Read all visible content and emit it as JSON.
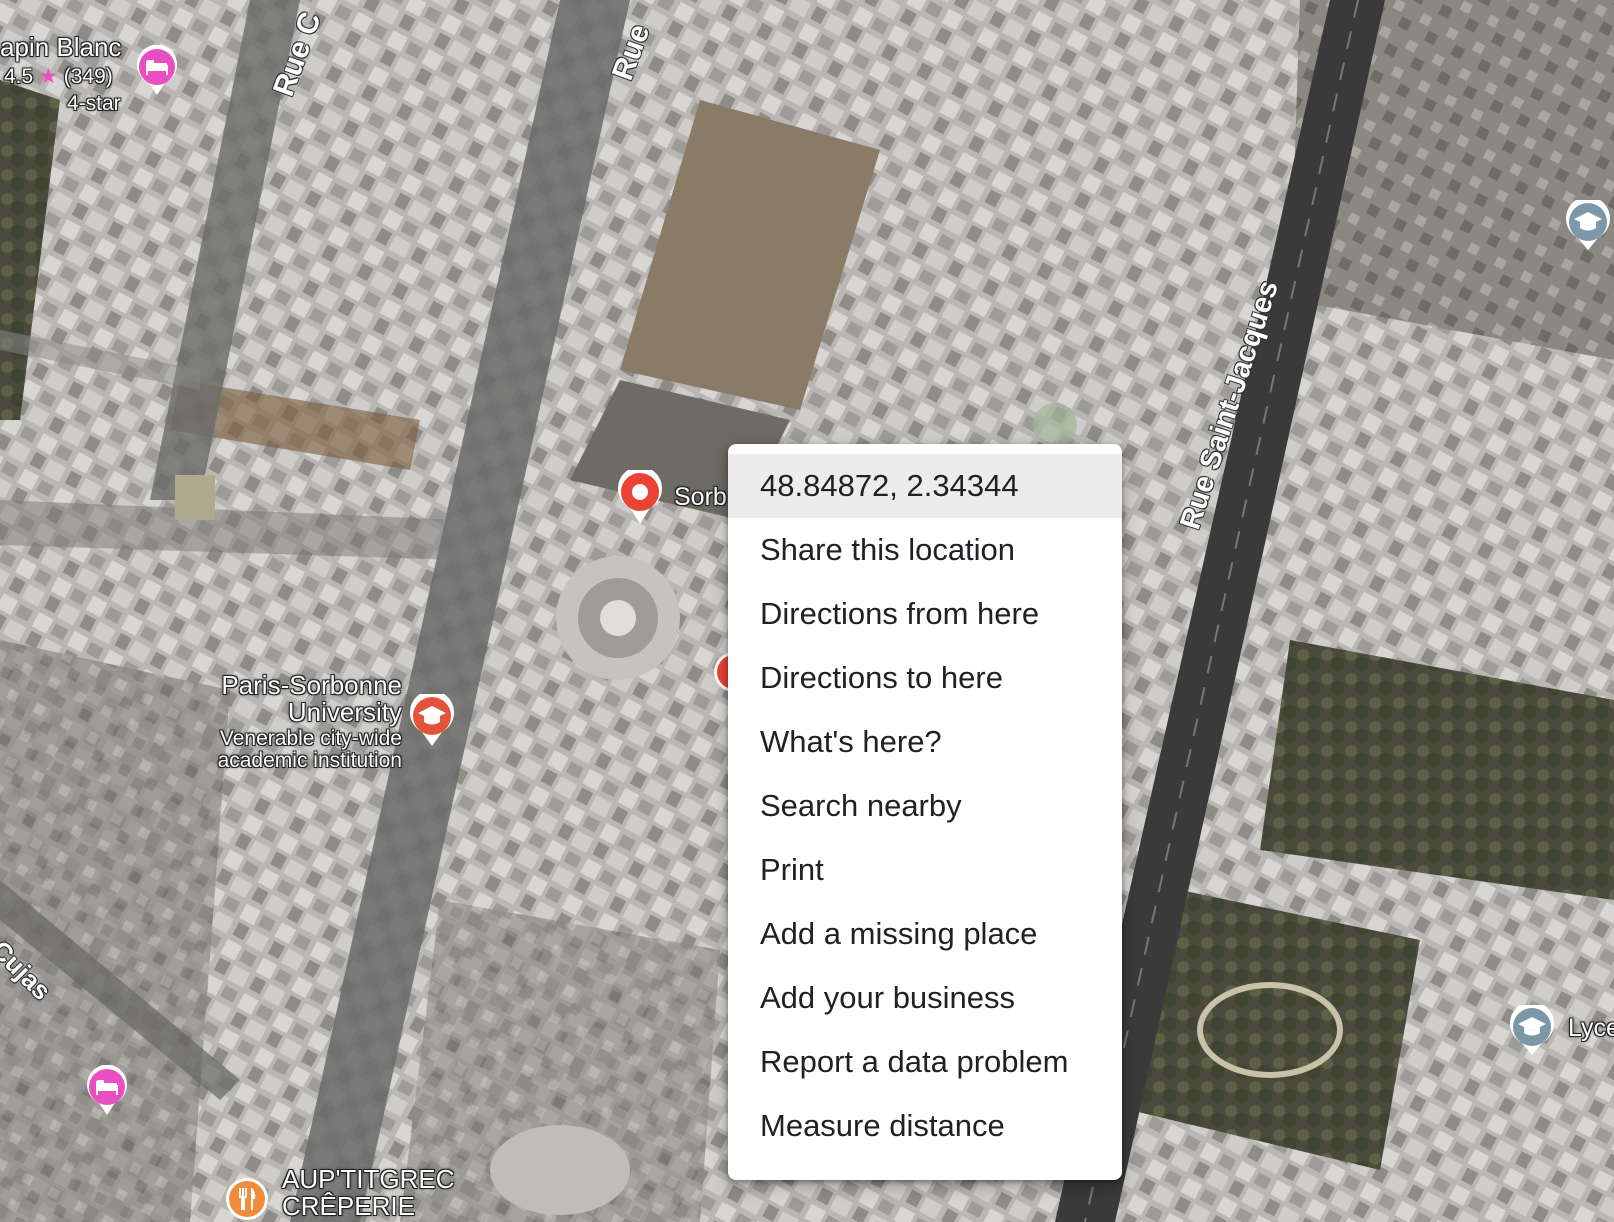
{
  "context_menu": {
    "coordinates": "48.84872, 2.34344",
    "items": [
      "Share this location",
      "Directions from here",
      "Directions to here",
      "What's here?",
      "Search nearby",
      "Print",
      "Add a missing place",
      "Add your business",
      "Report a data problem",
      "Measure distance"
    ]
  },
  "places": {
    "hotel_top": {
      "name": "apin Blanc",
      "rating": "4.5",
      "star": "★",
      "reviews": "(349)",
      "category": "4-star"
    },
    "university": {
      "name_line1": "Paris-Sorbonne",
      "name_line2": "University",
      "desc_line1": "Venerable city-wide",
      "desc_line2": "academic institution"
    },
    "sorbonne_pin_label": "Sorb",
    "lycee_label": "Lyce",
    "creperie_line1": "AUP'TITGREC",
    "creperie_line2": "CRÊPERIE"
  },
  "streets": {
    "rue_c": "Rue C",
    "rue": "Rue",
    "rue_saint_jacques": "Rue Saint-Jacques",
    "cujas": "Cujas"
  },
  "icons": {
    "hotel": "bed-icon",
    "university": "graduation-cap-icon",
    "restaurant": "fork-knife-icon",
    "selected": "location-pin-icon"
  },
  "colors": {
    "hotel_pin": "#e94fc0",
    "university_pin": "#e35239",
    "school_pin": "#7b98a9",
    "restaurant_pin": "#f28b3a",
    "selected_pin": "#ea4335",
    "rating_star": "#e94fc0"
  }
}
